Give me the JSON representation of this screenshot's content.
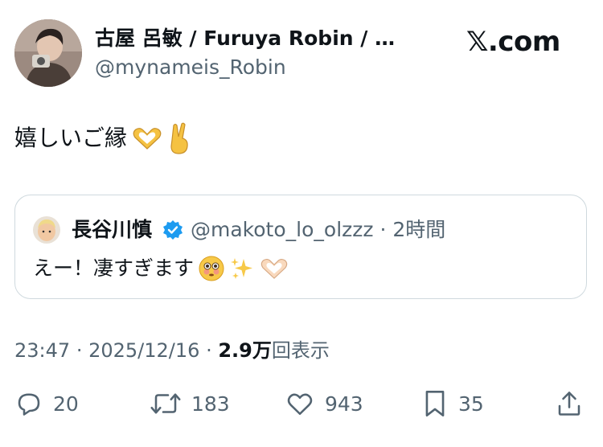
{
  "author": {
    "name": "古屋 呂敏 / Furuya Robin / ロ…",
    "handle": "@mynameis_Robin"
  },
  "brand": {
    "logo_text": "𝕏.com"
  },
  "tweet": {
    "text": "嬉しいご縁",
    "emojis": [
      "heart-hands-emoji",
      "victory-hand-emoji"
    ]
  },
  "quote": {
    "name": "長谷川慎",
    "handle": "@makoto_lo_olzzz",
    "separator": "·",
    "time": "2時間",
    "text": "えー！凄すぎます",
    "emojis": [
      "flushed-face-emoji",
      "sparkles-emoji",
      "heart-hands-emoji"
    ]
  },
  "meta": {
    "time": "23:47",
    "sep1": "·",
    "date": "2025/12/16",
    "sep2": "·",
    "views_count": "2.9万",
    "views_label": "回表示"
  },
  "actions": {
    "reply_count": "20",
    "retweet_count": "183",
    "like_count": "943",
    "bookmark_count": "35"
  },
  "colors": {
    "text": "#0f1419",
    "secondary": "#536471",
    "border": "#cfd9de",
    "verified": "#1d9bf0"
  }
}
